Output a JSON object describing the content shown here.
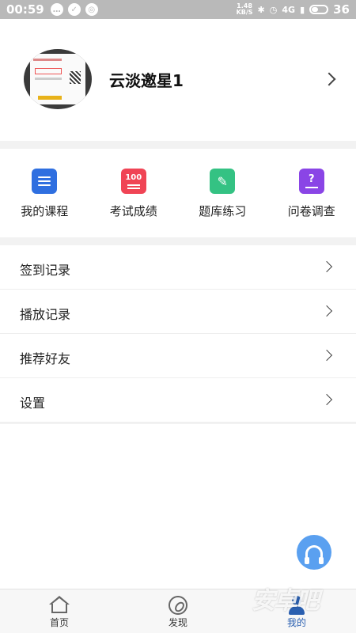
{
  "status_bar": {
    "time": "00:59",
    "net_speed_value": "1.48",
    "net_speed_unit": "KB/S",
    "network": "4G",
    "battery": "36"
  },
  "profile": {
    "username": "云淡邀星1"
  },
  "quick_actions": [
    {
      "label": "我的课程",
      "icon": "course-list-icon",
      "color": "#2f6fe0"
    },
    {
      "label": "考试成绩",
      "icon": "exam-score-icon",
      "color": "#f04455"
    },
    {
      "label": "题库练习",
      "icon": "question-bank-icon",
      "color": "#34c283"
    },
    {
      "label": "问卷调查",
      "icon": "survey-icon",
      "color": "#8a45e6"
    }
  ],
  "menu": [
    {
      "label": "签到记录"
    },
    {
      "label": "播放记录"
    },
    {
      "label": "推荐好友"
    },
    {
      "label": "设置"
    }
  ],
  "tabbar": {
    "home": "首页",
    "discover": "发现",
    "me": "我的",
    "active": "me"
  },
  "watermark": "安卓吧",
  "colors": {
    "accent": "#2a5fb0",
    "fab": "#5aa0f0",
    "status_bar": "#b9b9b9"
  }
}
